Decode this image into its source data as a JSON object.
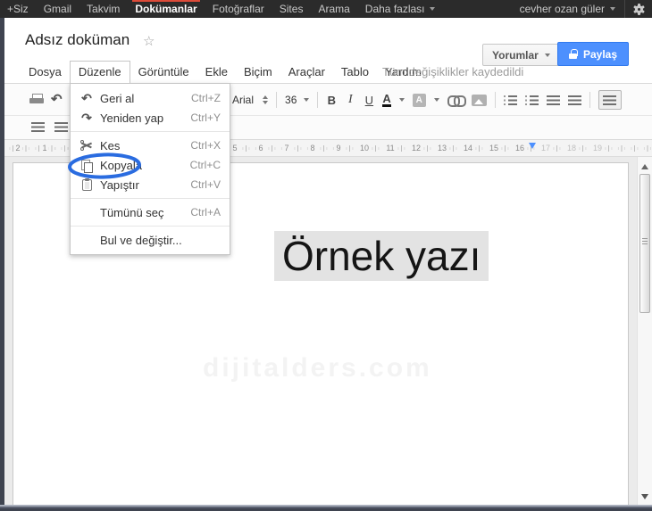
{
  "topbar": {
    "items": [
      "+Siz",
      "Gmail",
      "Takvim",
      "Dokümanlar",
      "Fotoğraflar",
      "Sites",
      "Arama",
      "Daha fazlası"
    ],
    "active_item": "Dokümanlar",
    "user": "cevher ozan güler",
    "accent_red": "#dd4b39",
    "bar_color": "#2b2b2b"
  },
  "header": {
    "title": "Adsız doküman",
    "star": "☆",
    "comments_button": "Yorumlar",
    "share_button": "Paylaş",
    "share_color": "#4d90fe",
    "saved_status": "Tüm değişiklikler kaydedildi"
  },
  "menubar": {
    "items": [
      "Dosya",
      "Düzenle",
      "Görüntüle",
      "Ekle",
      "Biçim",
      "Araçlar",
      "Tablo",
      "Yardım"
    ],
    "open_item": "Düzenle"
  },
  "edit_menu": {
    "items": [
      {
        "label": "Geri al",
        "shortcut": "Ctrl+Z",
        "icon": "undo-icon"
      },
      {
        "label": "Yeniden yap",
        "shortcut": "Ctrl+Y",
        "icon": "redo-icon"
      },
      {
        "label": "Kes",
        "shortcut": "Ctrl+X",
        "icon": "cut-icon"
      },
      {
        "label": "Kopyala",
        "shortcut": "Ctrl+C",
        "icon": "copy-icon"
      },
      {
        "label": "Yapıştır",
        "shortcut": "Ctrl+V",
        "icon": "paste-icon"
      },
      {
        "label": "Tümünü seç",
        "shortcut": "Ctrl+A",
        "icon": ""
      },
      {
        "label": "Bul ve değiştir...",
        "shortcut": "",
        "icon": ""
      }
    ],
    "circled_item": "Kopyala",
    "annotation_color": "#2a6ce0"
  },
  "toolbar": {
    "font_name": "Arial",
    "font_size": "36",
    "bold": "B",
    "italic": "I",
    "underline": "U",
    "text_color": "A",
    "highlight": "A"
  },
  "ruler": {
    "numbers": [
      "2",
      "1",
      "5",
      "6",
      "7",
      "8",
      "9",
      "10",
      "11",
      "12",
      "13",
      "14",
      "15",
      "16",
      "17",
      "18",
      "19"
    ],
    "marker_color": "#4d90fe"
  },
  "document": {
    "heading": "Örnek yazı",
    "watermark": "dijitalders.com"
  }
}
